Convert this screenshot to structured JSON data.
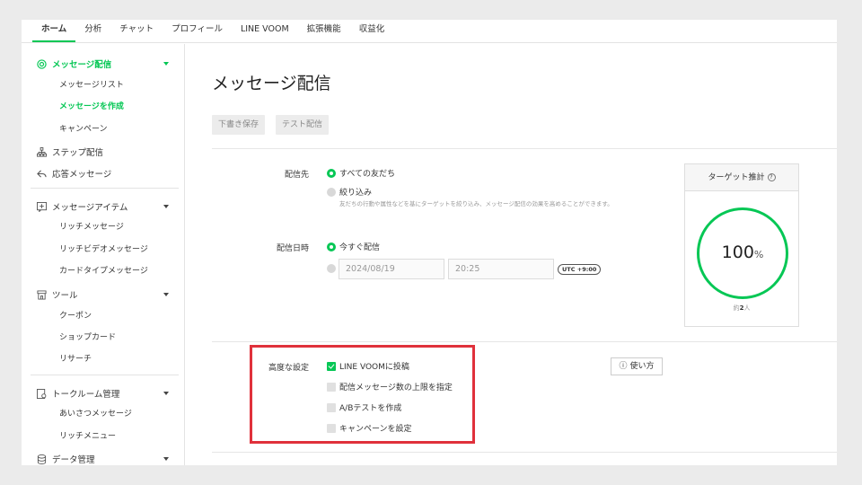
{
  "nav": {
    "tabs": [
      "ホーム",
      "分析",
      "チャット",
      "プロフィール",
      "LINE VOOM",
      "拡張機能",
      "収益化"
    ],
    "active_index": 0
  },
  "sidebar": {
    "message_delivery": {
      "label": "メッセージ配信",
      "items": [
        "メッセージリスト",
        "メッセージを作成",
        "キャンペーン"
      ],
      "active_item": 1
    },
    "step_delivery": "ステップ配信",
    "auto_response": "応答メッセージ",
    "message_items": {
      "label": "メッセージアイテム",
      "items": [
        "リッチメッセージ",
        "リッチビデオメッセージ",
        "カードタイプメッセージ"
      ]
    },
    "tools": {
      "label": "ツール",
      "items": [
        "クーポン",
        "ショップカード",
        "リサーチ"
      ]
    },
    "chatroom": {
      "label": "トークルーム管理",
      "items": [
        "あいさつメッセージ",
        "リッチメニュー"
      ]
    },
    "data": {
      "label": "データ管理"
    }
  },
  "main": {
    "title": "メッセージ配信",
    "save_draft": "下書き保存",
    "test_send": "テスト配信",
    "recipients": {
      "label": "配信先",
      "all_friends": "すべての友だち",
      "filter": "絞り込み",
      "filter_hint": "友だちの行動や属性などを基にターゲットを絞り込み、メッセージ配信の効果を高めることができます。"
    },
    "schedule": {
      "label": "配信日時",
      "now": "今すぐ配信",
      "date_placeholder": "2024/08/19",
      "time_placeholder": "20:25",
      "timezone": "UTC +9:00"
    },
    "target": {
      "title": "ターゲット推計",
      "percent": "100",
      "percent_sign": "%",
      "approx_prefix": "約",
      "approx_count": "2",
      "approx_suffix": "人"
    },
    "advanced": {
      "label": "高度な設定",
      "help": "使い方",
      "options": [
        {
          "label": "LINE VOOMに投稿",
          "checked": true
        },
        {
          "label": "配信メッセージ数の上限を指定",
          "checked": false
        },
        {
          "label": "A/Bテストを作成",
          "checked": false
        },
        {
          "label": "キャンペーンを設定",
          "checked": false
        }
      ]
    }
  },
  "colors": {
    "accent": "#06c755",
    "highlight": "#e0313b"
  }
}
